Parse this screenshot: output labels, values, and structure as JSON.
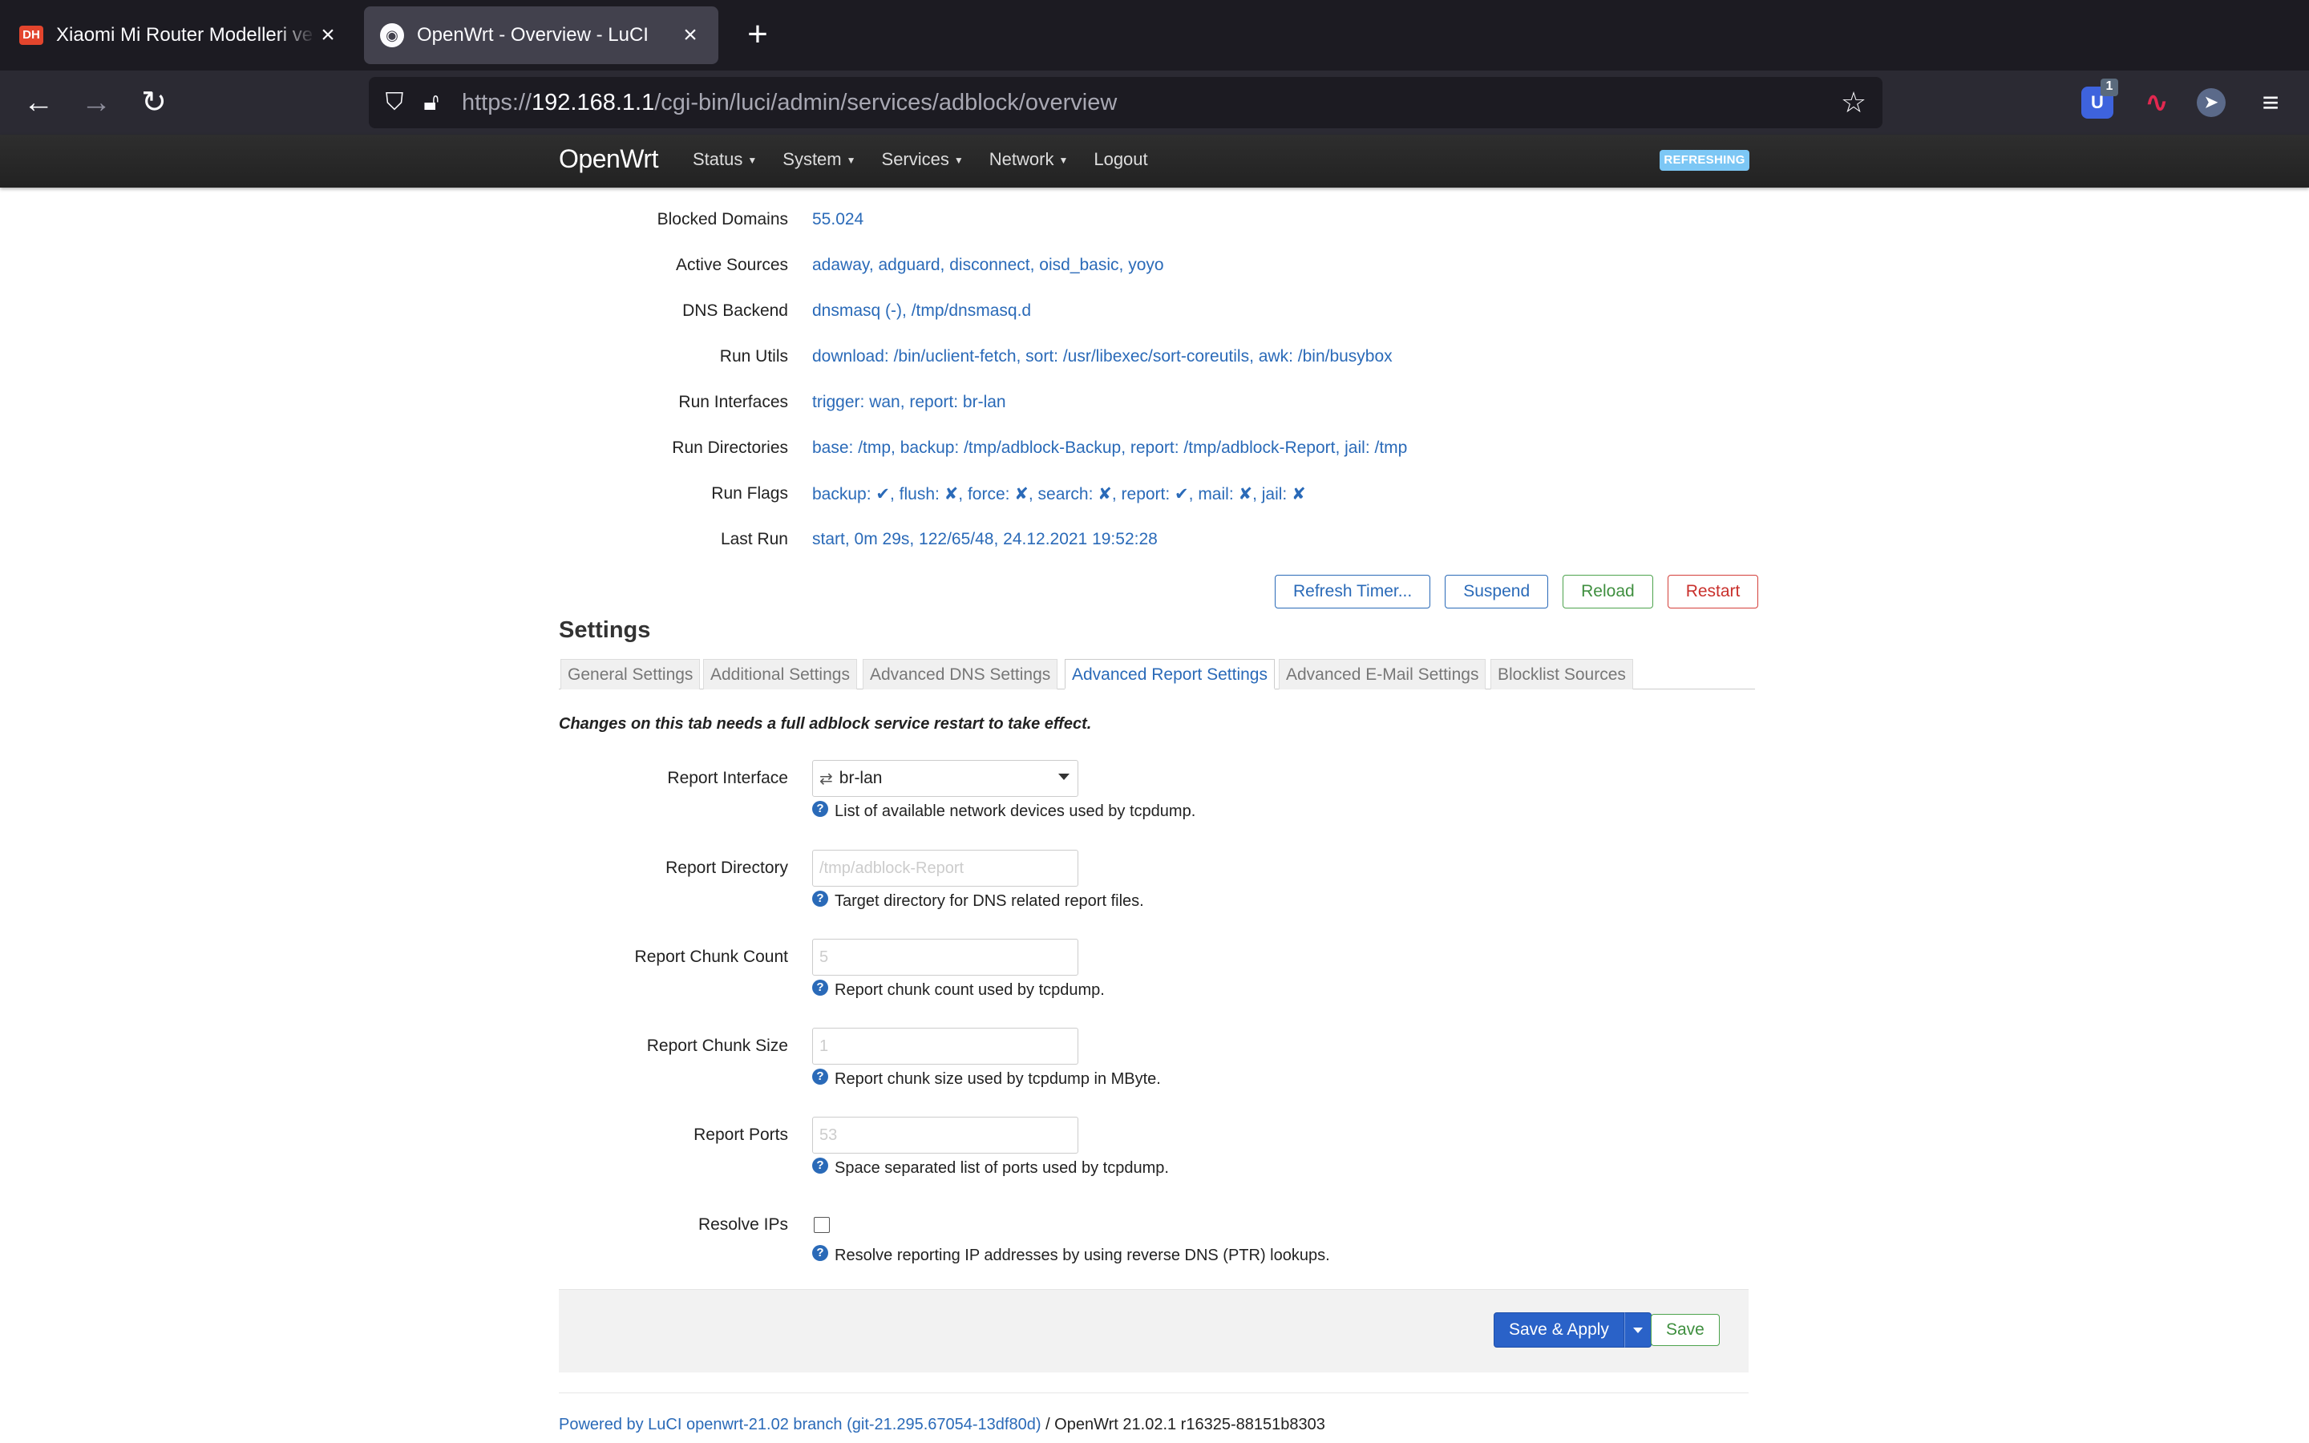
{
  "browser": {
    "tabs": [
      {
        "title": "Xiaomi Mi Router Modelleri ve OpenWrt",
        "favicon": "DH"
      },
      {
        "title": "OpenWrt - Overview - LuCI",
        "favicon": "openwrt-icon"
      }
    ],
    "new_tab": "+",
    "url_prefix": "https://",
    "url_host": "192.168.1.1",
    "url_path": "/cgi-bin/luci/admin/services/adblock/overview",
    "ext_badge": "1"
  },
  "header": {
    "brand": "OpenWrt",
    "menu": [
      "Status",
      "System",
      "Services",
      "Network",
      "Logout"
    ],
    "indicator": "REFRESHING"
  },
  "status": [
    {
      "label": "Blocked Domains",
      "value": "55.024"
    },
    {
      "label": "Active Sources",
      "value": "adaway, adguard, disconnect, oisd_basic, yoyo"
    },
    {
      "label": "DNS Backend",
      "value": "dnsmasq (-), /tmp/dnsmasq.d"
    },
    {
      "label": "Run Utils",
      "value": "download: /bin/uclient-fetch, sort: /usr/libexec/sort-coreutils, awk: /bin/busybox"
    },
    {
      "label": "Run Interfaces",
      "value": "trigger: wan, report: br-lan"
    },
    {
      "label": "Run Directories",
      "value": "base: /tmp, backup: /tmp/adblock-Backup, report: /tmp/adblock-Report, jail: /tmp"
    },
    {
      "label": "Run Flags",
      "value": "backup: ✔, flush: ✘, force: ✘, search: ✘, report: ✔, mail: ✘, jail: ✘"
    },
    {
      "label": "Last Run",
      "value": "start, 0m 29s, 122/65/48, 24.12.2021 19:52:28"
    }
  ],
  "actions": {
    "refresh_timer": "Refresh Timer...",
    "suspend": "Suspend",
    "reload": "Reload",
    "restart": "Restart"
  },
  "settings": {
    "heading": "Settings",
    "tabs": [
      "General Settings",
      "Additional Settings",
      "Advanced DNS Settings",
      "Advanced Report Settings",
      "Advanced E-Mail Settings",
      "Blocklist Sources"
    ],
    "active_tab": "Advanced Report Settings",
    "note": "Changes on this tab needs a full adblock service restart to take effect.",
    "fields": {
      "report_interface": {
        "label": "Report Interface",
        "value": "br-lan",
        "help": "List of available network devices used by tcpdump."
      },
      "report_directory": {
        "label": "Report Directory",
        "placeholder": "/tmp/adblock-Report",
        "help": "Target directory for DNS related report files."
      },
      "report_chunk_count": {
        "label": "Report Chunk Count",
        "placeholder": "5",
        "help": "Report chunk count used by tcpdump."
      },
      "report_chunk_size": {
        "label": "Report Chunk Size",
        "placeholder": "1",
        "help": "Report chunk size used by tcpdump in MByte."
      },
      "report_ports": {
        "label": "Report Ports",
        "placeholder": "53",
        "help": "Space separated list of ports used by tcpdump."
      },
      "resolve_ips": {
        "label": "Resolve IPs",
        "checked": false,
        "help": "Resolve reporting IP addresses by using reverse DNS (PTR) lookups."
      }
    }
  },
  "buttons": {
    "save_apply": "Save & Apply",
    "save": "Save"
  },
  "footer": {
    "link": "Powered by LuCI openwrt-21.02 branch (git-21.295.67054-13df80d)",
    "text": " / OpenWrt 21.02.1 r16325-88151b8303"
  },
  "colors": {
    "link": "#2a6ab8",
    "primary_button": "#2a62c8",
    "success": "#4da34d",
    "danger": "#d43f3a",
    "indicator": "#7cc7f5"
  }
}
